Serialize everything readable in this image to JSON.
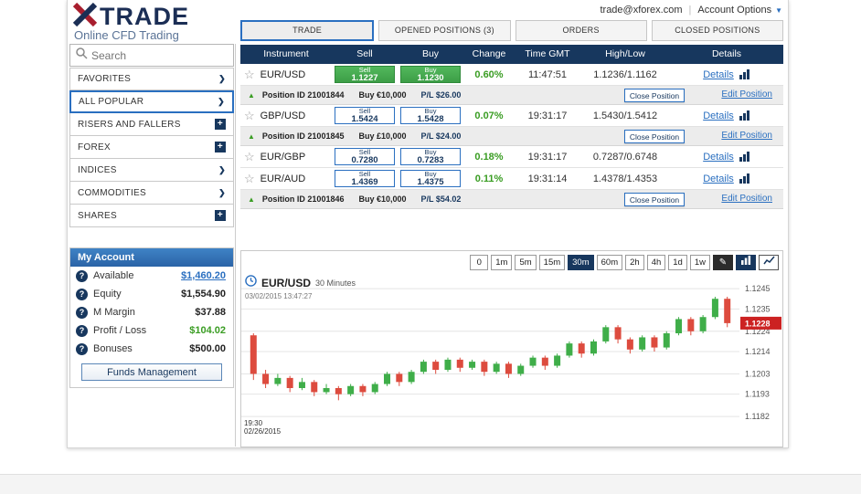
{
  "header": {
    "logo_text": "TRADE",
    "tagline": "Online CFD Trading",
    "email": "trade@xforex.com",
    "account_options_label": "Account Options"
  },
  "icons": {
    "star": "☆",
    "chevron_right": "❯",
    "plus": "+",
    "help": "?",
    "up_triangle": "▲",
    "pencil": "✎",
    "caret_down": "▼",
    "separator": "|"
  },
  "tabs": {
    "trade": "TRADE",
    "opened": "OPENED POSITIONS (3)",
    "orders": "ORDERS",
    "closed": "CLOSED POSITIONS"
  },
  "sidebar": {
    "search_placeholder": "Search",
    "items": [
      {
        "label": "FAVORITES"
      },
      {
        "label": "ALL POPULAR"
      },
      {
        "label": "RISERS AND FALLERS"
      },
      {
        "label": "FOREX"
      },
      {
        "label": "INDICES"
      },
      {
        "label": "COMMODITIES"
      },
      {
        "label": "SHARES"
      }
    ]
  },
  "account": {
    "title": "My Account",
    "available_label": "Available",
    "available_value": "$1,460.20",
    "equity_label": "Equity",
    "equity_value": "$1,554.90",
    "margin_label": "M Margin",
    "margin_value": "$37.88",
    "pl_label": "Profit / Loss",
    "pl_value": "$104.02",
    "bonuses_label": "Bonuses",
    "bonuses_value": "$500.00",
    "funds_button": "Funds Management"
  },
  "table": {
    "headers": [
      "Instrument",
      "Sell",
      "Buy",
      "Change",
      "Time GMT",
      "High/Low",
      "Details"
    ],
    "sell_label": "Sell",
    "buy_label": "Buy",
    "details_label": "Details",
    "close_label": "Close Position",
    "edit_label": "Edit Position",
    "rows": [
      {
        "instrument": "EUR/USD",
        "sell": "1.1227",
        "buy": "1.1230",
        "change": "0.60%",
        "time": "11:47:51",
        "high_low": "1.1236/1.1162"
      },
      {
        "instrument": "GBP/USD",
        "sell": "1.5424",
        "buy": "1.5428",
        "change": "0.07%",
        "time": "19:31:17",
        "high_low": "1.5430/1.5412"
      },
      {
        "instrument": "EUR/GBP",
        "sell": "0.7280",
        "buy": "0.7283",
        "change": "0.18%",
        "time": "19:31:17",
        "high_low": "0.7287/0.6748"
      },
      {
        "instrument": "EUR/AUD",
        "sell": "1.4369",
        "buy": "1.4375",
        "change": "0.11%",
        "time": "19:31:14",
        "high_low": "1.4378/1.4353"
      }
    ],
    "positions": [
      {
        "id_text": "Position ID 21001844",
        "order": "Buy €10,000",
        "pl": "P/L $26.00"
      },
      {
        "id_text": "Position ID 21001845",
        "order": "Buy £10,000",
        "pl": "P/L $24.00"
      },
      {
        "id_text": "Position ID 21001846",
        "order": "Buy €10,000",
        "pl": "P/L $54.02"
      }
    ]
  },
  "chart": {
    "timeframes": [
      "0",
      "1m",
      "5m",
      "15m",
      "30m",
      "60m",
      "2h",
      "4h",
      "1d",
      "1w"
    ],
    "active_timeframe": "30m",
    "symbol": "EUR/USD",
    "interval_label": "30 Minutes",
    "timestamp": "03/02/2015 13:47:27",
    "x_axis_time": "19:30",
    "x_axis_date": "02/26/2015",
    "chart_data": {
      "type": "candlestick",
      "title": "EUR/USD 30 Minutes",
      "y_ticks": [
        1.1245,
        1.1235,
        1.1224,
        1.1214,
        1.1203,
        1.1193,
        1.1182
      ],
      "ylim": [
        1.1178,
        1.125
      ],
      "current_price": 1.1228,
      "up_color": "#3fae49",
      "down_color": "#dd4b3e",
      "current_price_color": "#cc2222",
      "grid": true,
      "candles": [
        [
          1.1222,
          1.1223,
          1.12,
          1.1203
        ],
        [
          1.1203,
          1.1205,
          1.1196,
          1.1198
        ],
        [
          1.1198,
          1.1203,
          1.1197,
          1.1201
        ],
        [
          1.1201,
          1.1202,
          1.1194,
          1.1196
        ],
        [
          1.1196,
          1.1201,
          1.1195,
          1.1199
        ],
        [
          1.1199,
          1.12,
          1.1192,
          1.1194
        ],
        [
          1.1194,
          1.1198,
          1.1193,
          1.1196
        ],
        [
          1.1196,
          1.1197,
          1.119,
          1.1193
        ],
        [
          1.1193,
          1.1198,
          1.1192,
          1.1197
        ],
        [
          1.1197,
          1.1198,
          1.1192,
          1.1194
        ],
        [
          1.1194,
          1.1199,
          1.1193,
          1.1198
        ],
        [
          1.1198,
          1.1204,
          1.1197,
          1.1203
        ],
        [
          1.1203,
          1.1204,
          1.1197,
          1.1199
        ],
        [
          1.1199,
          1.1205,
          1.1198,
          1.1204
        ],
        [
          1.1204,
          1.121,
          1.1203,
          1.1209
        ],
        [
          1.1209,
          1.121,
          1.1203,
          1.1205
        ],
        [
          1.1205,
          1.1211,
          1.1204,
          1.121
        ],
        [
          1.121,
          1.1211,
          1.1204,
          1.1206
        ],
        [
          1.1206,
          1.121,
          1.1205,
          1.1209
        ],
        [
          1.1209,
          1.121,
          1.1202,
          1.1204
        ],
        [
          1.1204,
          1.1209,
          1.1203,
          1.1208
        ],
        [
          1.1208,
          1.1209,
          1.1201,
          1.1203
        ],
        [
          1.1203,
          1.1208,
          1.1202,
          1.1207
        ],
        [
          1.1207,
          1.1212,
          1.1206,
          1.1211
        ],
        [
          1.1211,
          1.1212,
          1.1205,
          1.1207
        ],
        [
          1.1207,
          1.1213,
          1.1206,
          1.1212
        ],
        [
          1.1212,
          1.1219,
          1.1211,
          1.1218
        ],
        [
          1.1218,
          1.1219,
          1.1211,
          1.1213
        ],
        [
          1.1213,
          1.122,
          1.1212,
          1.1219
        ],
        [
          1.1219,
          1.1227,
          1.1218,
          1.1226
        ],
        [
          1.1226,
          1.1227,
          1.1218,
          1.122
        ],
        [
          1.122,
          1.1221,
          1.1213,
          1.1215
        ],
        [
          1.1215,
          1.1222,
          1.1214,
          1.1221
        ],
        [
          1.1221,
          1.1222,
          1.1214,
          1.1216
        ],
        [
          1.1216,
          1.1224,
          1.1215,
          1.1223
        ],
        [
          1.1223,
          1.1231,
          1.1222,
          1.123
        ],
        [
          1.123,
          1.1231,
          1.1222,
          1.1224
        ],
        [
          1.1224,
          1.1232,
          1.1223,
          1.1231
        ],
        [
          1.1231,
          1.1241,
          1.123,
          1.124
        ],
        [
          1.124,
          1.1241,
          1.1226,
          1.1228
        ]
      ]
    }
  },
  "colors": {
    "navy": "#17375e",
    "blue": "#2a6fc0",
    "green": "#3a9d23"
  }
}
